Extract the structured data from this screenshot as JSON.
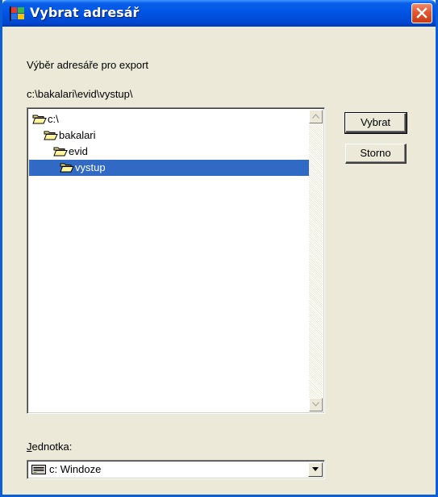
{
  "window": {
    "title": "Vybrat adresář",
    "icon": "app-flag-icon",
    "close_icon": "close-icon"
  },
  "dialog": {
    "caption": "Výběr adresáře pro export",
    "current_path": "c:\\bakalari\\evid\\vystup\\"
  },
  "tree": {
    "items": [
      {
        "label": "c:\\",
        "icon": "open-folder-icon",
        "selected": false
      },
      {
        "label": "bakalari",
        "icon": "open-folder-icon",
        "selected": false
      },
      {
        "label": "evid",
        "icon": "open-folder-icon",
        "selected": false
      },
      {
        "label": "vystup",
        "icon": "open-folder-icon",
        "selected": true
      }
    ]
  },
  "buttons": {
    "select_label": "Vybrat",
    "cancel_label": "Storno"
  },
  "drive": {
    "label_underlined": "J",
    "label_rest": "ednotka:",
    "value": "c: Windoze",
    "icon": "hard-drive-icon"
  },
  "colors": {
    "titlebar": "#0055e5",
    "selection": "#316ac5",
    "dialog_bg": "#ece9d8",
    "close_button": "#e2562f"
  }
}
